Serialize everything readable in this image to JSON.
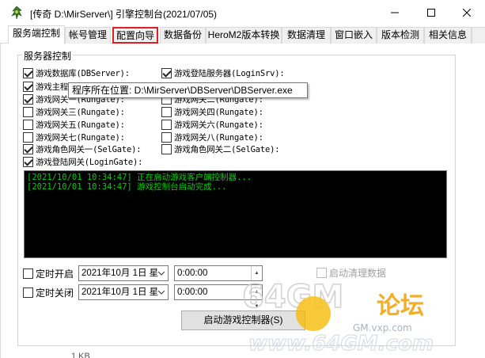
{
  "window": {
    "title": "[传奇 D:\\MirServer\\] 引擎控制台(2021/07/05)"
  },
  "tabs": [
    {
      "label": "服务端控制"
    },
    {
      "label": "帐号管理"
    },
    {
      "label": "配置向导"
    },
    {
      "label": "数据备份"
    },
    {
      "label": "HeroM2版本转换"
    },
    {
      "label": "数据清理"
    },
    {
      "label": "窗口嵌入"
    },
    {
      "label": "版本检测"
    },
    {
      "label": "相关信息"
    }
  ],
  "group": {
    "title": "服务器控制"
  },
  "checkboxes": {
    "db_server": {
      "label": "游戏数据库(DBServer):",
      "checked": true
    },
    "login_srv": {
      "label": "游戏登陆服务器(LoginSrv):",
      "checked": true
    },
    "m2_server": {
      "label": "游戏主程",
      "checked": true
    },
    "run_gate_1": {
      "label": "游戏网关一(Rungate):",
      "checked": true
    },
    "run_gate_2": {
      "label": "游戏网关二(Rungate):",
      "checked": false
    },
    "run_gate_3": {
      "label": "游戏网关三(Rungate):",
      "checked": false
    },
    "run_gate_4": {
      "label": "游戏网关四(Rungate):",
      "checked": false
    },
    "run_gate_5": {
      "label": "游戏网关五(Rungate):",
      "checked": false
    },
    "run_gate_6": {
      "label": "游戏网关六(Rungate):",
      "checked": false
    },
    "run_gate_7": {
      "label": "游戏网关七(Rungate):",
      "checked": false
    },
    "run_gate_8": {
      "label": "游戏网关八(Rungate):",
      "checked": false
    },
    "sel_gate_1": {
      "label": "游戏角色网关一(SelGate):",
      "checked": true
    },
    "sel_gate_2": {
      "label": "游戏角色网关二(SelGate):",
      "checked": false
    },
    "login_gate": {
      "label": "游戏登陆网关(LoginGate):",
      "checked": true
    }
  },
  "tooltip": {
    "text": "程序所在位置: D:\\MirServer\\DBServer\\DBServer.exe"
  },
  "console": {
    "lines": [
      "[2021/10/01 10:34:47] 正在启动游戏客户端控制器...",
      "[2021/10/01 10:34:47] 游戏控制台启动完成..."
    ]
  },
  "schedule": {
    "start": {
      "label": "定时开启",
      "checked": false,
      "date": "2021年10月 1日 星",
      "time": "0:00:00"
    },
    "stop": {
      "label": "定时关闭",
      "checked": false,
      "date": "2021年10月 1日 星",
      "time": "0:00:00"
    },
    "auto_clear": {
      "label": "启动清理数据",
      "checked": false
    }
  },
  "buttons": {
    "start_controller": "启动游戏控制器(S)"
  },
  "status": {
    "partial_text": "1 KB"
  },
  "watermark": {
    "text": "64GM论坛",
    "url": "www.64GM.com",
    "sub": "GM.vxp.com"
  },
  "colors": {
    "console_bg": "#000000",
    "console_text": "#00d000",
    "highlight_border": "#e02020"
  }
}
